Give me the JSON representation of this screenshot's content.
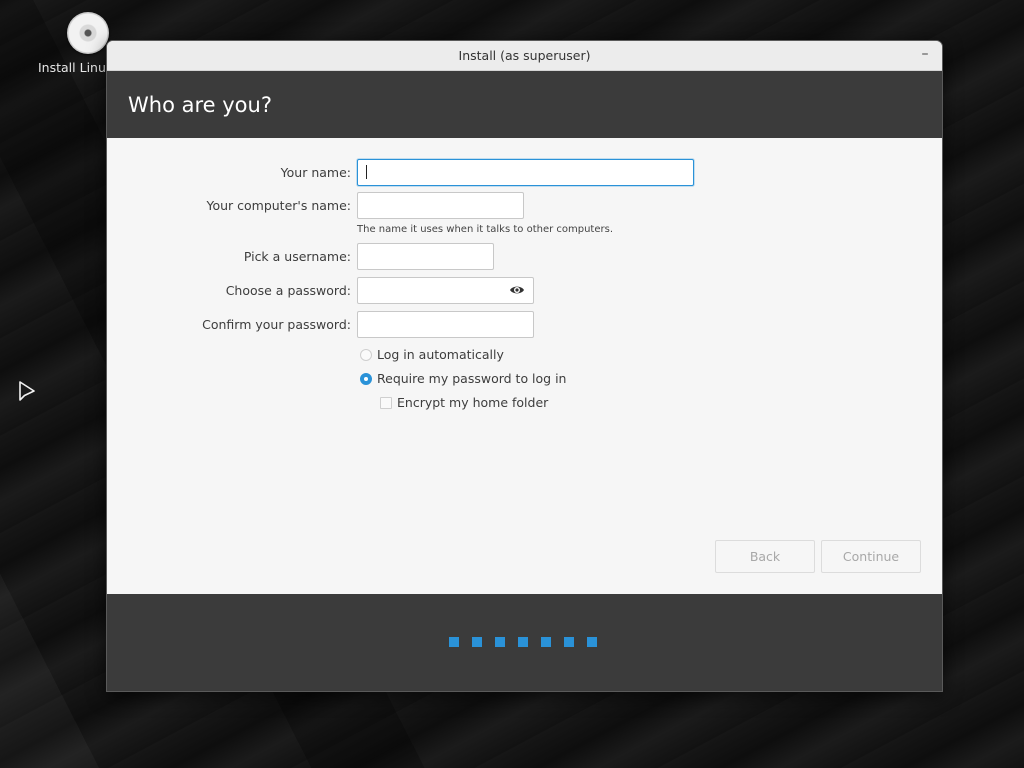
{
  "desktop": {
    "icon_label": "Install Linux",
    "icon": "disc-icon"
  },
  "window": {
    "title": "Install (as superuser)",
    "minimize_glyph": "–"
  },
  "header": {
    "title": "Who are you?"
  },
  "form": {
    "your_name": {
      "label": "Your name:",
      "value": ""
    },
    "computer_name": {
      "label": "Your computer's name:",
      "value": "",
      "hint": "The name it uses when it talks to other computers."
    },
    "username": {
      "label": "Pick a username:",
      "value": ""
    },
    "password": {
      "label": "Choose a password:",
      "value": "",
      "icon": "eye-icon"
    },
    "confirm_password": {
      "label": "Confirm your password:",
      "value": ""
    },
    "login_auto": {
      "label": "Log in automatically",
      "checked": false
    },
    "login_require": {
      "label": "Require my password to log in",
      "checked": true
    },
    "encrypt_home": {
      "label": "Encrypt my home folder",
      "checked": false
    }
  },
  "buttons": {
    "back": "Back",
    "continue": "Continue"
  },
  "progress": {
    "dots": 7
  },
  "colors": {
    "accent": "#2a92d8",
    "header_bg": "#3b3b3b"
  }
}
